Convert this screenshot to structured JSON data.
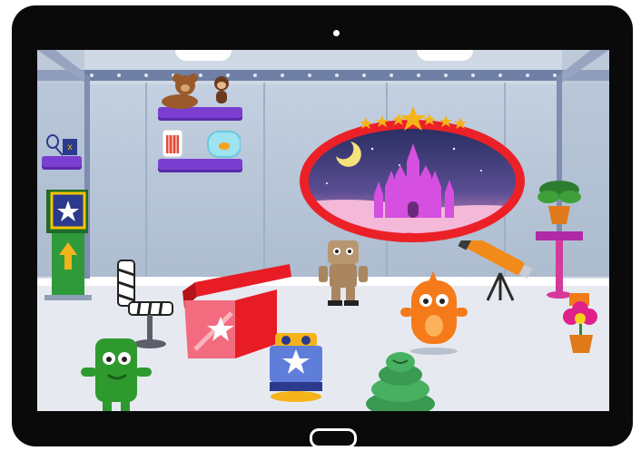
{
  "device": {
    "type": "tablet",
    "frame_color": "#0a0a0a"
  },
  "scene": {
    "name": "kids-game-room",
    "wall_color": "#b9c6d6",
    "floor_color": "#e6eaf0",
    "accent_red": "#ec2127",
    "shelf_purple": "#7a3fd0",
    "castle_pink": "#d54fe0"
  },
  "icons": {
    "star": "star-icon",
    "arrow_up": "arrow-up-icon",
    "moon": "moon-icon"
  }
}
